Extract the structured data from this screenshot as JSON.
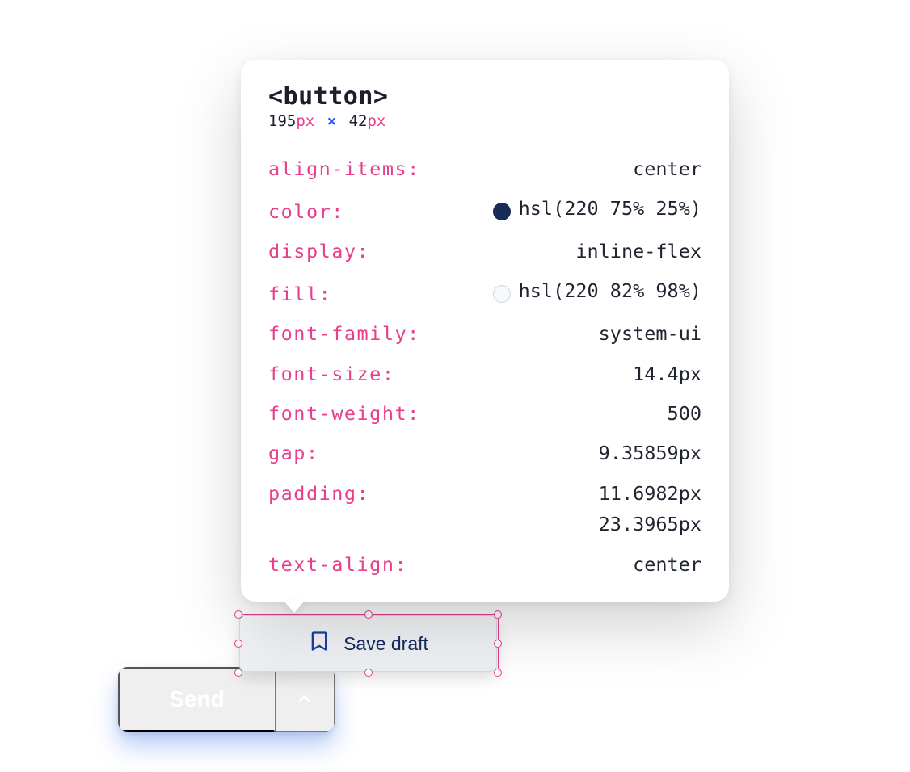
{
  "inspector": {
    "tag": "<button>",
    "width_num": "195",
    "height_num": "42",
    "unit": "px",
    "rows": [
      {
        "key": "align-items",
        "value": "center"
      },
      {
        "key": "color",
        "value": "hsl(220 75% 25%)",
        "swatch": "#172d58"
      },
      {
        "key": "display",
        "value": "inline-flex"
      },
      {
        "key": "fill",
        "value": "hsl(220 82% 98%)",
        "swatch": "#f6f9fe"
      },
      {
        "key": "font-family",
        "value": "system-ui"
      },
      {
        "key": "font-size",
        "value": "14.4px"
      },
      {
        "key": "font-weight",
        "value": "500"
      },
      {
        "key": "gap",
        "value": "9.35859px"
      },
      {
        "key": "padding",
        "value": "11.6982px",
        "value2": "23.3965px"
      },
      {
        "key": "text-align",
        "value": "center"
      }
    ]
  },
  "save_draft": {
    "label": "Save draft"
  },
  "send": {
    "label": "Send"
  }
}
